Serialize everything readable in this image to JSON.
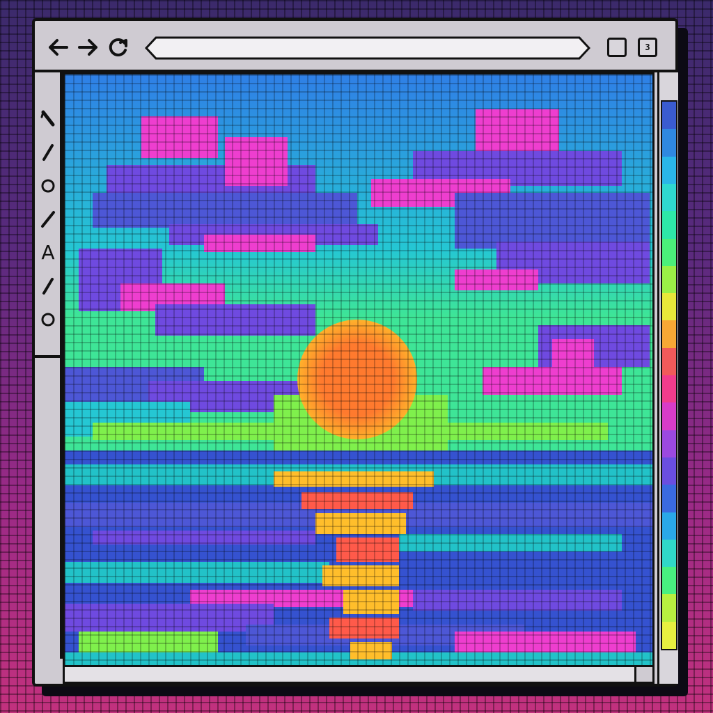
{
  "toolbar": {
    "back_icon": "arrow-left-icon",
    "forward_icon": "arrow-right-icon",
    "reload_icon": "reload-icon",
    "url": "",
    "restore_icon": "square-icon",
    "tabs_count": "3"
  },
  "tools": [
    {
      "name": "pencil-tool",
      "icon": "pencil-icon"
    },
    {
      "name": "line-tool-1",
      "icon": "line-icon"
    },
    {
      "name": "circle-tool-1",
      "icon": "circle-icon"
    },
    {
      "name": "line-tool-2",
      "icon": "line-icon"
    },
    {
      "name": "text-tool",
      "icon": "text-icon",
      "label": "A"
    },
    {
      "name": "line-tool-3",
      "icon": "line-icon"
    },
    {
      "name": "circle-tool-2",
      "icon": "circle-icon"
    }
  ],
  "palette": {
    "colors": [
      "#3a5bd0",
      "#2f88e0",
      "#2ab6e8",
      "#2fd8d0",
      "#2ee8a8",
      "#4bf07a",
      "#9af046",
      "#e8e83a",
      "#f7a835",
      "#f05a5a",
      "#f03c8c",
      "#d83cc8",
      "#9b49e0",
      "#6a4ee0",
      "#3a6ae0",
      "#2aa8e8",
      "#30d8c8",
      "#48f080",
      "#b8f040",
      "#e8f040"
    ]
  },
  "canvas": {
    "colors": {
      "sky_top": "#2f7fe6",
      "sky_mid": "#25c7d3",
      "sky_low": "#3ee597",
      "cloud_purple": "#6f4ae0",
      "cloud_pink": "#ee3ecf",
      "cloud_blue": "#4d57d6",
      "sun_core": "#ff7a2e",
      "sun_edge": "#ffb12b",
      "horizon_green": "#7ff04c",
      "sea_deep": "#3552d0",
      "sea_teal": "#22c2c8",
      "reflection": "#ffbe2b",
      "reflection_hot": "#ff5a4a"
    }
  }
}
